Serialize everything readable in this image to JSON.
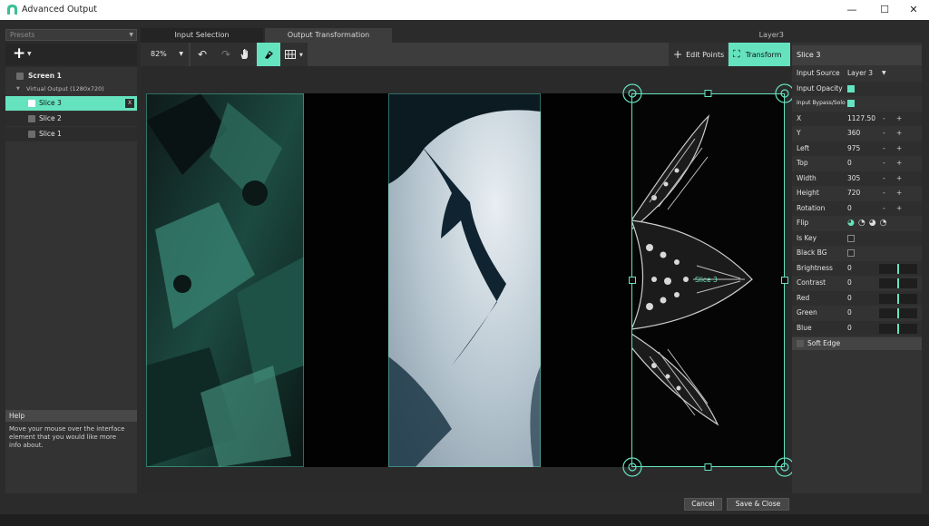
{
  "window": {
    "title": "Advanced Output",
    "minimize_glyph": "—",
    "maximize_glyph": "☐",
    "close_glyph": "✕"
  },
  "left_panel": {
    "presets_label": "Presets",
    "add_glyph": "+",
    "tree": {
      "screen_label": "Screen 1",
      "virtual_output_label": "Virtual Output (1280x720)",
      "slices": [
        {
          "label": "Slice 3",
          "selected": true
        },
        {
          "label": "Slice 2",
          "selected": false
        },
        {
          "label": "Slice 1",
          "selected": false
        }
      ],
      "remove_glyph": "X"
    },
    "help": {
      "title": "Help",
      "text": "Move your mouse over the interface element that you would like more info about."
    }
  },
  "tabs": {
    "input_selection": "Input Selection",
    "output_transformation": "Output Transformation",
    "active": "output_transformation",
    "layer_label": "Layer3"
  },
  "toolbar": {
    "zoom": "82%",
    "edit_points_label": "Edit Points",
    "transform_label": "Transform",
    "icons": [
      "undo-icon",
      "redo-icon",
      "hand-icon",
      "marker-icon",
      "grid-icon"
    ]
  },
  "canvas": {
    "slice_overlay_label": "Slice 3"
  },
  "properties": {
    "title": "Slice 3",
    "input_source_label": "Input Source",
    "input_source_value": "Layer 3",
    "input_opacity_label": "Input Opacity",
    "input_opacity_checked": true,
    "input_bypass_label": "Input Bypass/Solo",
    "input_bypass_checked": true,
    "x_label": "X",
    "x_value": "1127.50",
    "y_label": "Y",
    "y_value": "360",
    "left_label": "Left",
    "left_value": "975",
    "top_label": "Top",
    "top_value": "0",
    "width_label": "Width",
    "width_value": "305",
    "height_label": "Height",
    "height_value": "720",
    "rotation_label": "Rotation",
    "rotation_value": "0",
    "flip_label": "Flip",
    "is_key_label": "Is Key",
    "is_key_checked": false,
    "black_bg_label": "Black BG",
    "black_bg_checked": false,
    "brightness_label": "Brightness",
    "brightness_value": "0",
    "contrast_label": "Contrast",
    "contrast_value": "0",
    "red_label": "Red",
    "red_value": "0",
    "green_label": "Green",
    "green_value": "0",
    "blue_label": "Blue",
    "blue_value": "0",
    "soft_edge_label": "Soft Edge",
    "minus_glyph": "-",
    "plus_glyph": "+"
  },
  "footer": {
    "cancel_label": "Cancel",
    "save_close_label": "Save & Close"
  },
  "colors": {
    "accent": "#65e3bf",
    "panel": "#333333",
    "background": "#2b2b2b"
  }
}
